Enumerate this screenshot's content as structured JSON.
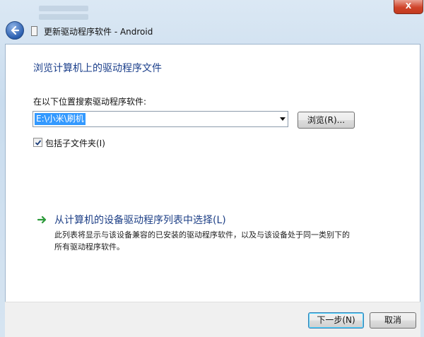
{
  "window": {
    "title": "更新驱动程序软件 - Android",
    "close_label": "X"
  },
  "page": {
    "heading": "浏览计算机上的驱动程序文件",
    "search_label": "在以下位置搜索驱动程序软件:",
    "path_value": "E:\\小米\\刷机",
    "browse_label": "浏览(R)...",
    "include_subfolders_label": "包括子文件夹(I)",
    "include_subfolders_checked": true
  },
  "pick_option": {
    "title": "从计算机的设备驱动程序列表中选择(L)",
    "description_line1": "此列表将显示与该设备兼容的已安装的驱动程序软件，以及与该设备处于同一类别下的",
    "description_line2": "所有驱动程序软件。"
  },
  "footer": {
    "next_label": "下一步(N)",
    "cancel_label": "取消"
  },
  "colors": {
    "heading_blue": "#1b3f8b",
    "selection_blue": "#3399ff",
    "arrow_green": "#2c9a3a",
    "close_red": "#c23a1f"
  },
  "icons": [
    "back-arrow-icon",
    "document-icon",
    "dropdown-arrow-icon",
    "checkmark-icon",
    "green-arrow-icon"
  ]
}
